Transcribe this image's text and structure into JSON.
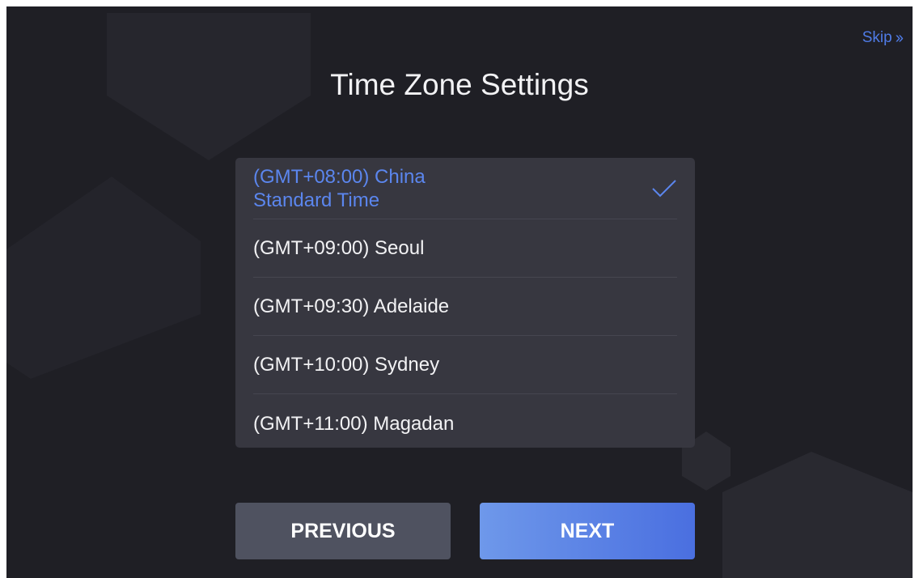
{
  "header": {
    "skip_label": "Skip",
    "skip_icon": "double-chevron-right-icon",
    "title": "Time Zone Settings"
  },
  "timezones": {
    "selected_index": 0,
    "items": [
      {
        "label": "(GMT+08:00) China Standard Time",
        "selected": true
      },
      {
        "label": "(GMT+09:00) Seoul",
        "selected": false
      },
      {
        "label": "(GMT+09:30) Adelaide",
        "selected": false
      },
      {
        "label": "(GMT+10:00) Sydney",
        "selected": false
      },
      {
        "label": "(GMT+11:00) Magadan",
        "selected": false
      }
    ]
  },
  "buttons": {
    "previous_label": "PREVIOUS",
    "next_label": "NEXT"
  },
  "colors": {
    "background": "#1f1f25",
    "accent": "#4f7be6",
    "list_background": "#373740",
    "previous_button": "#4f5260",
    "next_button_start": "#6e98ea",
    "next_button_end": "#4a6fe0"
  }
}
